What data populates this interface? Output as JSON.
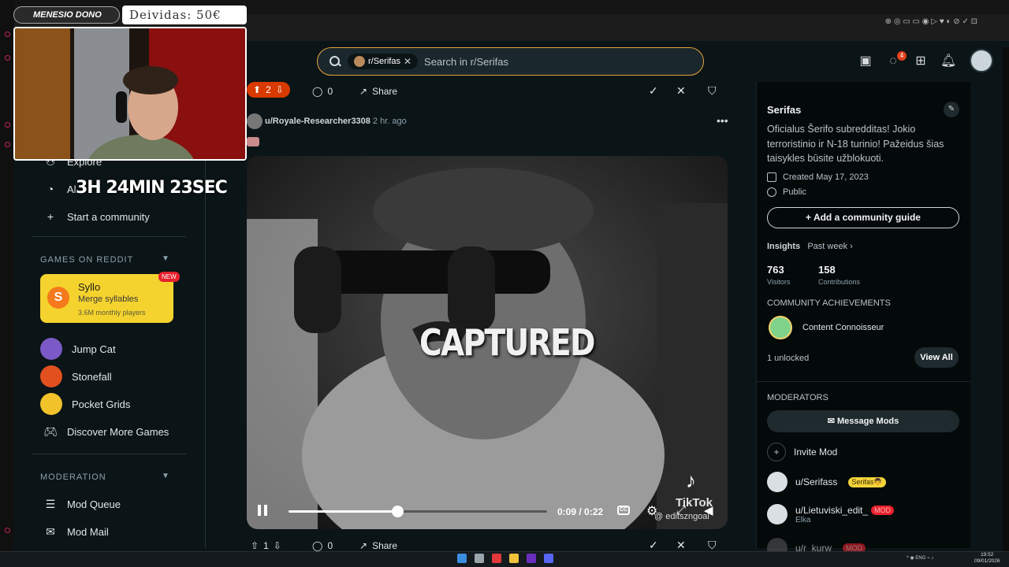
{
  "overlay": {
    "donor_label": "MENESIO DONO",
    "debt_label": "Deividas: 50€",
    "timer": "3H 24MIN 23SEC"
  },
  "header": {
    "search_chip": "r/Serifas",
    "search_placeholder": "Search in r/Serifas",
    "chat_badge": "4"
  },
  "sidebar": {
    "items_top": [
      {
        "label": "Explore",
        "icon": "compass-icon"
      },
      {
        "label": "Al",
        "icon": "stats-icon"
      },
      {
        "label": "Start a community",
        "icon": "plus-icon"
      }
    ],
    "games_section": "GAMES ON REDDIT",
    "featured_game": {
      "title": "Syllo",
      "subtitle": "Merge syllables",
      "players": "3.6M monthly players",
      "badge": "NEW",
      "logo": "S"
    },
    "games": [
      {
        "label": "Jump Cat",
        "color": "#7b5ac7"
      },
      {
        "label": "Stonefall",
        "color": "#e2501f"
      },
      {
        "label": "Pocket Grids",
        "color": "#f2c22a"
      },
      {
        "label": "Discover More Games",
        "color": ""
      }
    ],
    "moderation_section": "MODERATION",
    "moderation": [
      {
        "label": "Mod Queue"
      },
      {
        "label": "Mod Mail"
      }
    ]
  },
  "post": {
    "votes": "2",
    "comments": "0",
    "share": "Share",
    "author": "u/Royale-Researcher3308",
    "time": "• 2 hr. ago",
    "video_caption": "CAPTURED",
    "watermark_name": "TikTok",
    "watermark_user": "@ editszngoal",
    "video_time": "0:09 / 0:22",
    "progress": 0.42
  },
  "next_post": {
    "votes": "1",
    "comments": "0",
    "share": "Share"
  },
  "right_panel": {
    "title": "Serifas",
    "description": "Oficialus Šerifo subredditas! Jokio terroristinio ir N-18 turinio! Pažeidus šias taisykles būsite užblokuoti.",
    "created": "Created May 17, 2023",
    "visibility": "Public",
    "add_guide": "Add a community guide",
    "insights": "Insights",
    "insights_period": "Past week ›",
    "visitors_num": "763",
    "visitors_lbl": "Visitors",
    "contrib_num": "158",
    "contrib_lbl": "Contributions",
    "achievements_title": "COMMUNITY ACHIEVEMENTS",
    "achievement": "Content Connoisseur",
    "unlocked": "1 unlocked",
    "view_all": "View All",
    "moderators_title": "MODERATORS",
    "message_mods": "Message Mods",
    "invite_mod": "Invite Mod",
    "mods": [
      {
        "name": "u/Serifass",
        "flair": "Serifas👨",
        "flair_bg": "#f2d23a",
        "flair_fg": "#3a2a00",
        "sub": ""
      },
      {
        "name": "u/Lietuviski_edit_",
        "flair": "MOD",
        "flair_bg": "#e8212d",
        "flair_fg": "#ffb3b3",
        "sub": "Elka"
      },
      {
        "name": "u/r_kurw",
        "flair": "MOD",
        "flair_bg": "#e8212d",
        "flair_fg": "#ffb3b3",
        "sub": ""
      }
    ]
  },
  "taskbar": {
    "time": "19:52",
    "date": "09/01/2026",
    "lang": "ENG"
  }
}
